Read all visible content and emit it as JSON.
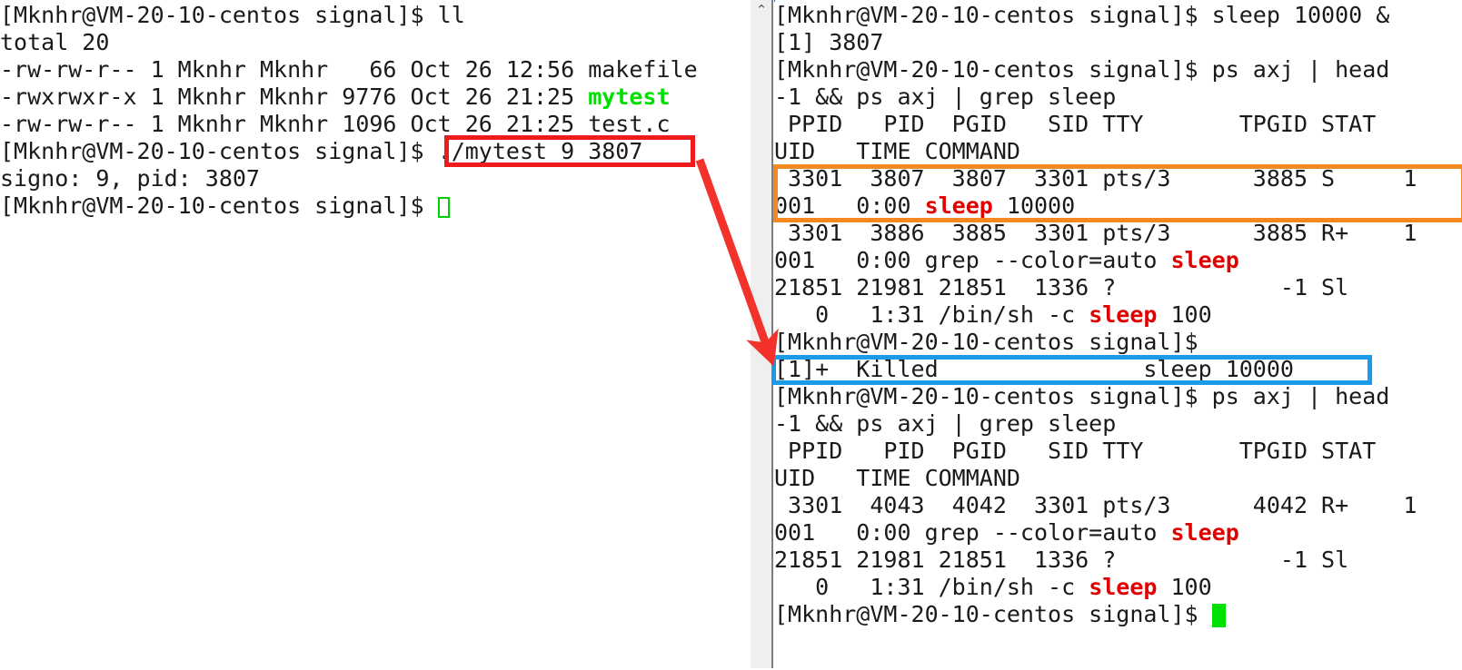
{
  "app": {
    "title": "Terminal — signal demo (two panes)",
    "prompt": "[Mknhr@VM-20-10-centos signal]$"
  },
  "colors": {
    "background": "#ffffff",
    "foreground": "#1a1a1a",
    "highlight_green": "#00e000",
    "highlight_red": "#e00000",
    "anno_red": "#ee1c1c",
    "anno_orange": "#f5881f",
    "anno_blue": "#1a9ae8",
    "scrollbar_track": "#efefef"
  },
  "scrollbar": {
    "up_arrow_glyph": "⌃"
  },
  "left_pane": {
    "name": "left-terminal",
    "lines": [
      [
        {
          "t": "[Mknhr@VM-20-10-centos signal]$ ll",
          "c": "plain"
        }
      ],
      [
        {
          "t": "total 20",
          "c": "plain"
        }
      ],
      [
        {
          "t": "-rw-rw-r-- 1 Mknhr Mknhr   66 Oct 26 12:56 makefile",
          "c": "plain"
        }
      ],
      [
        {
          "t": "-rwxrwxr-x 1 Mknhr Mknhr 9776 Oct 26 21:25 ",
          "c": "plain"
        },
        {
          "t": "mytest",
          "c": "green"
        }
      ],
      [
        {
          "t": "-rw-rw-r-- 1 Mknhr Mknhr 1096 Oct 26 21:25 test.c",
          "c": "plain"
        }
      ],
      [
        {
          "t": "[Mknhr@VM-20-10-centos signal]$ ./mytest 9 3807",
          "c": "plain"
        }
      ],
      [
        {
          "t": "signo: 9, pid: 3807",
          "c": "plain"
        }
      ],
      [
        {
          "t": "[Mknhr@VM-20-10-centos signal]$ ",
          "c": "plain"
        },
        {
          "t": "",
          "c": "cursor-hollow"
        }
      ]
    ]
  },
  "right_pane": {
    "name": "right-terminal",
    "lines": [
      [
        {
          "t": "[Mknhr@VM-20-10-centos signal]$ sleep 10000 &",
          "c": "plain"
        }
      ],
      [
        {
          "t": "[1] 3807",
          "c": "plain"
        }
      ],
      [
        {
          "t": "[Mknhr@VM-20-10-centos signal]$ ps axj | head",
          "c": "plain"
        }
      ],
      [
        {
          "t": "-1 && ps axj | grep sleep",
          "c": "plain"
        }
      ],
      [
        {
          "t": " PPID   PID  PGID   SID TTY       TPGID STAT",
          "c": "plain"
        }
      ],
      [
        {
          "t": "UID   TIME COMMAND",
          "c": "plain"
        }
      ],
      [
        {
          "t": " 3301  3807  3807  3301 pts/3      3885 S     1",
          "c": "plain"
        }
      ],
      [
        {
          "t": "001   0:00 ",
          "c": "plain"
        },
        {
          "t": "sleep",
          "c": "red"
        },
        {
          "t": " 10000",
          "c": "plain"
        }
      ],
      [
        {
          "t": " 3301  3886  3885  3301 pts/3      3885 R+    1",
          "c": "plain"
        }
      ],
      [
        {
          "t": "001   0:00 grep --color=auto ",
          "c": "plain"
        },
        {
          "t": "sleep",
          "c": "red"
        }
      ],
      [
        {
          "t": "21851 21981 21851  1336 ?            -1 Sl",
          "c": "plain"
        }
      ],
      [
        {
          "t": "   0   1:31 /bin/sh -c ",
          "c": "plain"
        },
        {
          "t": "sleep",
          "c": "red"
        },
        {
          "t": " 100",
          "c": "plain"
        }
      ],
      [
        {
          "t": "[Mknhr@VM-20-10-centos signal]$",
          "c": "plain"
        }
      ],
      [
        {
          "t": "[1]+  Killed               sleep 10000",
          "c": "plain"
        }
      ],
      [
        {
          "t": "[Mknhr@VM-20-10-centos signal]$ ps axj | head",
          "c": "plain"
        }
      ],
      [
        {
          "t": "-1 && ps axj | grep sleep",
          "c": "plain"
        }
      ],
      [
        {
          "t": " PPID   PID  PGID   SID TTY       TPGID STAT",
          "c": "plain"
        }
      ],
      [
        {
          "t": "UID   TIME COMMAND",
          "c": "plain"
        }
      ],
      [
        {
          "t": " 3301  4043  4042  3301 pts/3      4042 R+    1",
          "c": "plain"
        }
      ],
      [
        {
          "t": "001   0:00 grep --color=auto ",
          "c": "plain"
        },
        {
          "t": "sleep",
          "c": "red"
        }
      ],
      [
        {
          "t": "21851 21981 21851  1336 ?            -1 Sl",
          "c": "plain"
        }
      ],
      [
        {
          "t": "   0   1:31 /bin/sh -c ",
          "c": "plain"
        },
        {
          "t": "sleep",
          "c": "red"
        },
        {
          "t": " 100",
          "c": "plain"
        }
      ],
      [
        {
          "t": "[Mknhr@VM-20-10-centos signal]$ ",
          "c": "plain"
        },
        {
          "t": "",
          "c": "cursor-block"
        }
      ]
    ]
  },
  "annotations": {
    "red_box": {
      "label": "./mytest 9 3807",
      "meaning": "command-sending-signal-9-to-pid-3807"
    },
    "orange_box": {
      "label": "3301  3807  3807  3301 pts/3      3885 S     1001   0:00 sleep 10000",
      "meaning": "sleep-process-row-before-kill"
    },
    "blue_box": {
      "label": "[1]+  Killed               sleep 10000",
      "meaning": "job-killed-notification"
    },
    "arrow": {
      "meaning": "points-from-mytest-command-to-killed-notification"
    }
  }
}
